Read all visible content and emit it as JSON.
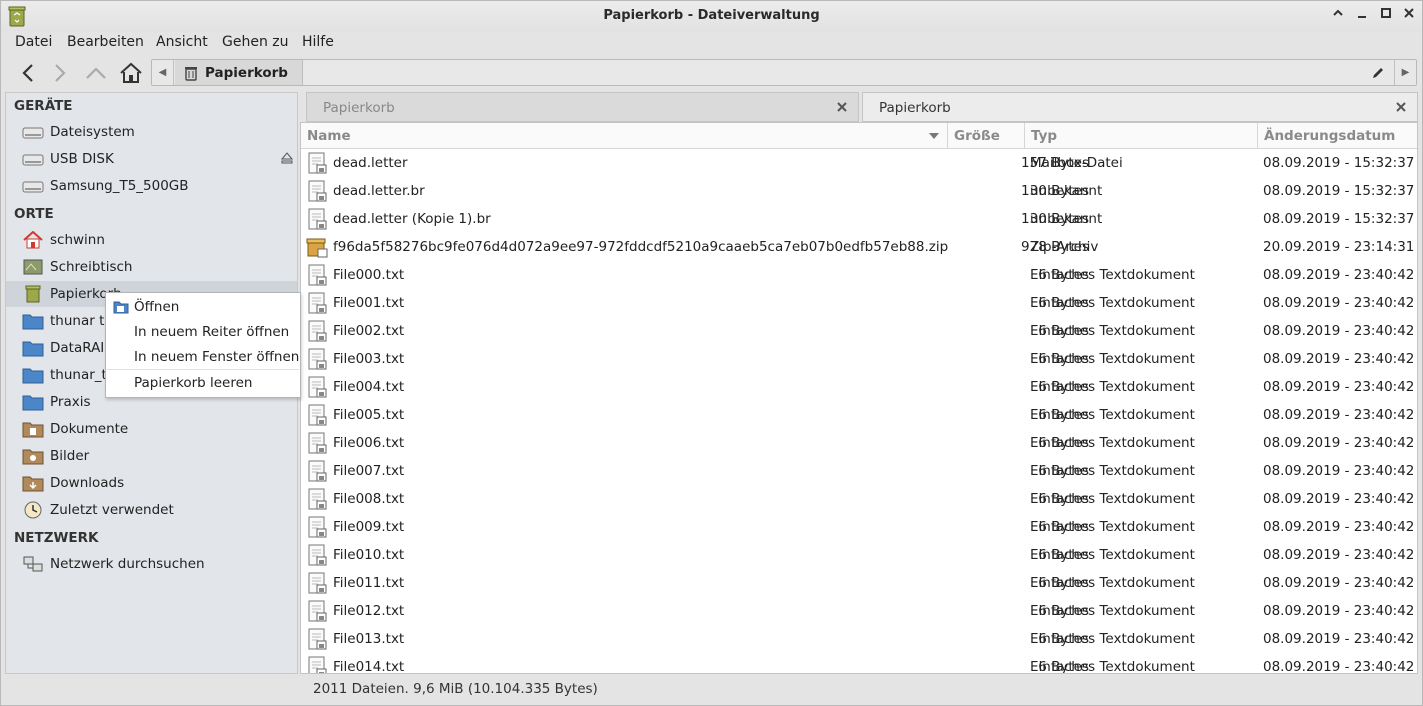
{
  "window": {
    "title": "Papierkorb - Dateiverwaltung"
  },
  "menubar": [
    "Datei",
    "Bearbeiten",
    "Ansicht",
    "Gehen zu",
    "Hilfe"
  ],
  "pathbar": {
    "crumb": "Papierkorb"
  },
  "sidebar": {
    "sections": {
      "devices": "GERÄTE",
      "places": "ORTE",
      "network": "NETZWERK"
    },
    "devices": [
      {
        "label": "Dateisystem",
        "icon": "drive-icon"
      },
      {
        "label": "USB DISK",
        "icon": "drive-icon"
      },
      {
        "label": "Samsung_T5_500GB",
        "icon": "drive-icon"
      }
    ],
    "places": [
      {
        "label": "schwinn",
        "icon": "home-icon"
      },
      {
        "label": "Schreibtisch",
        "icon": "desktop-icon"
      },
      {
        "label": "Papierkorb",
        "icon": "trash-icon"
      },
      {
        "label": "thunar te",
        "icon": "folder-icon"
      },
      {
        "label": "DataRAID",
        "icon": "folder-icon"
      },
      {
        "label": "thunar_te",
        "icon": "folder-icon"
      },
      {
        "label": "Praxis",
        "icon": "folder-icon"
      },
      {
        "label": "Dokumente",
        "icon": "documents-folder-icon"
      },
      {
        "label": "Bilder",
        "icon": "pictures-folder-icon"
      },
      {
        "label": "Downloads",
        "icon": "downloads-folder-icon"
      },
      {
        "label": "Zuletzt verwendet",
        "icon": "clock-icon"
      }
    ],
    "network": [
      {
        "label": "Netzwerk durchsuchen",
        "icon": "network-icon"
      }
    ]
  },
  "tabs": [
    {
      "label": "Papierkorb",
      "active": false
    },
    {
      "label": "Papierkorb",
      "active": true
    }
  ],
  "table": {
    "columns": [
      "Name",
      "Größe",
      "Typ",
      "Änderungsdatum"
    ],
    "rows": [
      {
        "name": "dead.letter",
        "size": "157 Bytes",
        "type": "Mailbox-Datei",
        "date": "08.09.2019 - 15:32:37",
        "icon": "text-file-icon"
      },
      {
        "name": "dead.letter.br",
        "size": "130 Bytes",
        "type": "unbekannt",
        "date": "08.09.2019 - 15:32:37",
        "icon": "text-file-icon"
      },
      {
        "name": "dead.letter (Kopie 1).br",
        "size": "130 Bytes",
        "type": "unbekannt",
        "date": "08.09.2019 - 15:32:37",
        "icon": "text-file-icon"
      },
      {
        "name": "f96da5f58276bc9fe076d4d072a9ee97-972fddcdf5210a9caaeb5ca7eb07b0edfb57eb88.zip",
        "size": "978 Bytes",
        "type": "Zip-Archiv",
        "date": "20.09.2019 - 23:14:31",
        "icon": "archive-icon"
      },
      {
        "name": "File000.txt",
        "size": "6 Bytes",
        "type": "Einfaches Textdokument",
        "date": "08.09.2019 - 23:40:42",
        "icon": "text-file-icon"
      },
      {
        "name": "File001.txt",
        "size": "6 Bytes",
        "type": "Einfaches Textdokument",
        "date": "08.09.2019 - 23:40:42",
        "icon": "text-file-icon"
      },
      {
        "name": "File002.txt",
        "size": "6 Bytes",
        "type": "Einfaches Textdokument",
        "date": "08.09.2019 - 23:40:42",
        "icon": "text-file-icon"
      },
      {
        "name": "File003.txt",
        "size": "6 Bytes",
        "type": "Einfaches Textdokument",
        "date": "08.09.2019 - 23:40:42",
        "icon": "text-file-icon"
      },
      {
        "name": "File004.txt",
        "size": "6 Bytes",
        "type": "Einfaches Textdokument",
        "date": "08.09.2019 - 23:40:42",
        "icon": "text-file-icon"
      },
      {
        "name": "File005.txt",
        "size": "6 Bytes",
        "type": "Einfaches Textdokument",
        "date": "08.09.2019 - 23:40:42",
        "icon": "text-file-icon"
      },
      {
        "name": "File006.txt",
        "size": "6 Bytes",
        "type": "Einfaches Textdokument",
        "date": "08.09.2019 - 23:40:42",
        "icon": "text-file-icon"
      },
      {
        "name": "File007.txt",
        "size": "6 Bytes",
        "type": "Einfaches Textdokument",
        "date": "08.09.2019 - 23:40:42",
        "icon": "text-file-icon"
      },
      {
        "name": "File008.txt",
        "size": "6 Bytes",
        "type": "Einfaches Textdokument",
        "date": "08.09.2019 - 23:40:42",
        "icon": "text-file-icon"
      },
      {
        "name": "File009.txt",
        "size": "6 Bytes",
        "type": "Einfaches Textdokument",
        "date": "08.09.2019 - 23:40:42",
        "icon": "text-file-icon"
      },
      {
        "name": "File010.txt",
        "size": "6 Bytes",
        "type": "Einfaches Textdokument",
        "date": "08.09.2019 - 23:40:42",
        "icon": "text-file-icon"
      },
      {
        "name": "File011.txt",
        "size": "6 Bytes",
        "type": "Einfaches Textdokument",
        "date": "08.09.2019 - 23:40:42",
        "icon": "text-file-icon"
      },
      {
        "name": "File012.txt",
        "size": "6 Bytes",
        "type": "Einfaches Textdokument",
        "date": "08.09.2019 - 23:40:42",
        "icon": "text-file-icon"
      },
      {
        "name": "File013.txt",
        "size": "6 Bytes",
        "type": "Einfaches Textdokument",
        "date": "08.09.2019 - 23:40:42",
        "icon": "text-file-icon"
      },
      {
        "name": "File014.txt",
        "size": "6 Bytes",
        "type": "Einfaches Textdokument",
        "date": "08.09.2019 - 23:40:42",
        "icon": "text-file-icon"
      }
    ]
  },
  "statusbar": {
    "text": "2011 Dateien. 9,6 MiB (10.104.335 Bytes)"
  },
  "context_menu": {
    "items": [
      "Öffnen",
      "In neuem Reiter öffnen",
      "In neuem Fenster öffnen",
      "Papierkorb leeren"
    ]
  },
  "colors": {
    "selection": "#cfd4db",
    "sidebar_bg": "#e2e5ea",
    "folder_blue": "#4a86c8",
    "home_red": "#d03a2f"
  }
}
